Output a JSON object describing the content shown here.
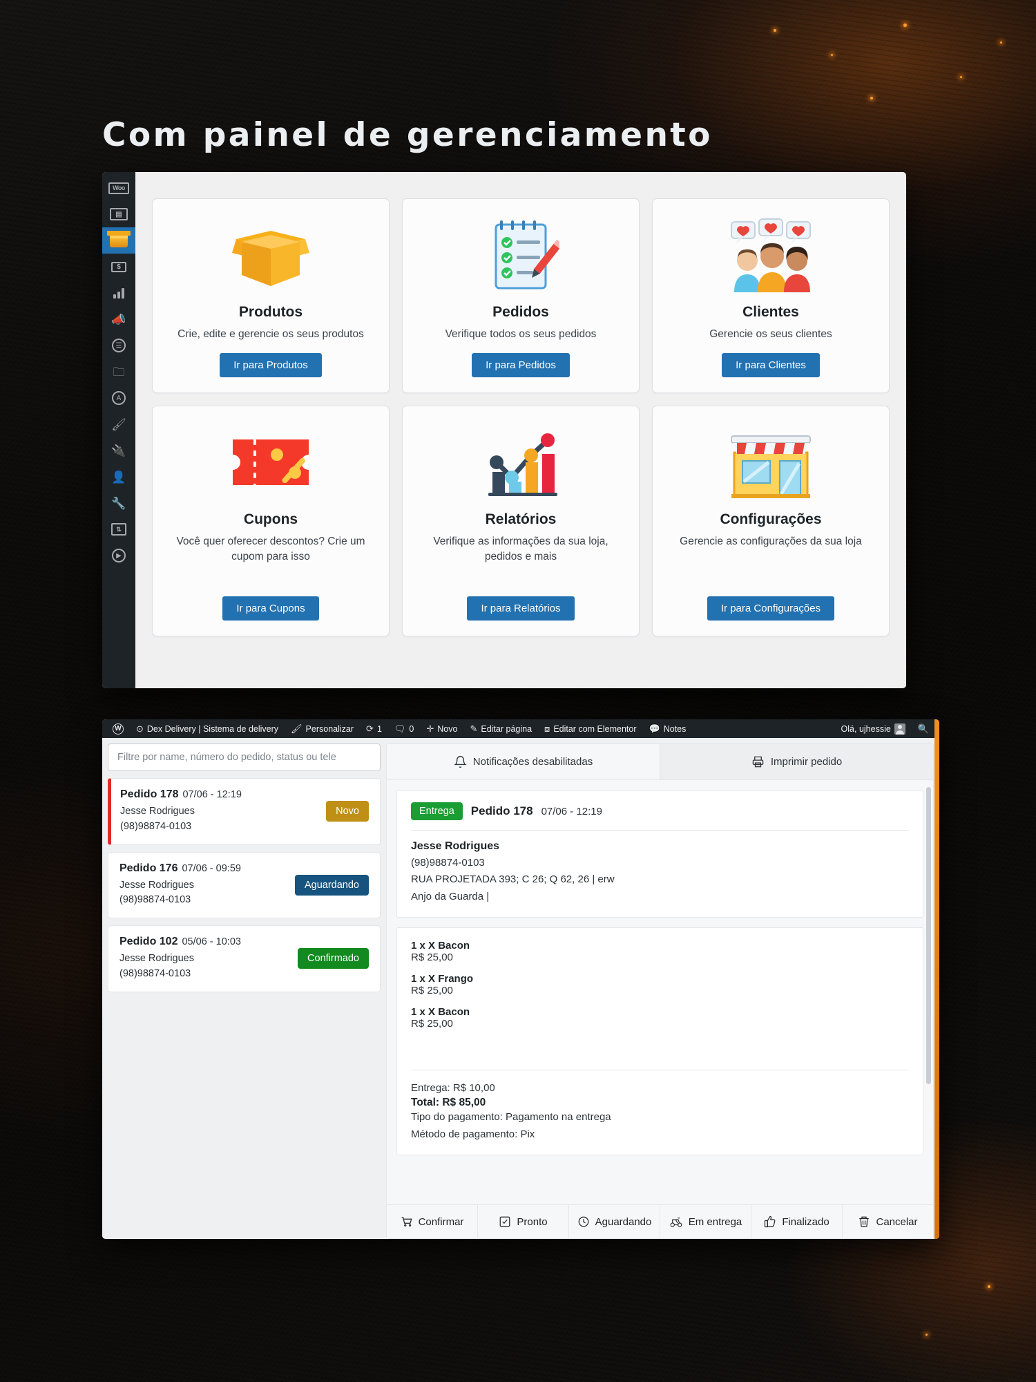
{
  "headline": "Com painel de gerenciamento",
  "dashboard": {
    "rail": [
      {
        "name": "woocommerce-icon",
        "glyph": "Woo"
      },
      {
        "name": "pages-icon",
        "glyph": "▤"
      },
      {
        "name": "products-icon",
        "glyph": "box"
      },
      {
        "name": "payments-icon",
        "glyph": "S"
      },
      {
        "name": "analytics-icon",
        "glyph": "bars"
      },
      {
        "name": "marketing-icon",
        "glyph": "📣"
      },
      {
        "name": "elementor-icon",
        "glyph": "E"
      },
      {
        "name": "media-icon",
        "glyph": "🗀"
      },
      {
        "name": "astra-icon",
        "glyph": "A"
      },
      {
        "name": "appearance-icon",
        "glyph": "🖌"
      },
      {
        "name": "plugins-icon",
        "glyph": "🔌"
      },
      {
        "name": "users-icon",
        "glyph": "👤"
      },
      {
        "name": "tools-icon",
        "glyph": "🔧"
      },
      {
        "name": "settings-icon",
        "glyph": "⇅"
      },
      {
        "name": "collapse-icon",
        "glyph": "▶"
      }
    ],
    "cards": [
      {
        "id": "produtos",
        "icon": "open-box-icon",
        "title": "Produtos",
        "desc": "Crie, edite e gerencie os seus produtos",
        "button": "Ir para Produtos"
      },
      {
        "id": "pedidos",
        "icon": "checklist-icon",
        "title": "Pedidos",
        "desc": "Verifique todos os seus pedidos",
        "button": "Ir para Pedidos"
      },
      {
        "id": "clientes",
        "icon": "customers-icon",
        "title": "Clientes",
        "desc": "Gerencie os seus clientes",
        "button": "Ir para Clientes"
      },
      {
        "id": "cupons",
        "icon": "coupon-icon",
        "title": "Cupons",
        "desc": "Você quer oferecer descontos? Crie um cupom para isso",
        "button": "Ir para Cupons"
      },
      {
        "id": "relatorios",
        "icon": "bar-chart-icon",
        "title": "Relatórios",
        "desc": "Verifique as informações da sua loja, pedidos e mais",
        "button": "Ir para Relatórios"
      },
      {
        "id": "configuracoes",
        "icon": "storefront-icon",
        "title": "Configurações",
        "desc": "Gerencie as configurações da sua loja",
        "button": "Ir para Configurações"
      }
    ]
  },
  "delivery": {
    "adminbar": {
      "site_name": "Dex Delivery | Sistema de delivery",
      "customize": "Personalizar",
      "updates_count": "1",
      "comments_count": "0",
      "new": "Novo",
      "edit_page": "Editar página",
      "edit_elementor": "Editar com Elementor",
      "notes": "Notes",
      "greeting": "Olá, ujhessie"
    },
    "filter_placeholder": "Filtre por name, número do pedido, status ou tele",
    "orders": [
      {
        "number": "Pedido 178",
        "datetime": "07/06 - 12:19",
        "customer": "Jesse Rodrigues",
        "phone": "(98)98874-0103",
        "status": "Novo",
        "status_color": "#bf8f16",
        "selected": true
      },
      {
        "number": "Pedido 176",
        "datetime": "07/06 - 09:59",
        "customer": "Jesse Rodrigues",
        "phone": "(98)98874-0103",
        "status": "Aguardando",
        "status_color": "#16537e",
        "selected": false
      },
      {
        "number": "Pedido 102",
        "datetime": "05/06 - 10:03",
        "customer": "Jesse Rodrigues",
        "phone": "(98)98874-0103",
        "status": "Confirmado",
        "status_color": "#128a1f",
        "selected": false
      }
    ],
    "detail_tabs": [
      {
        "label": "Notificações desabilitadas",
        "icon": "bell-icon"
      },
      {
        "label": "Imprimir pedido",
        "icon": "printer-icon"
      }
    ],
    "detail": {
      "chip": "Entrega",
      "chip_color": "#1a9e34",
      "number": "Pedido 178",
      "datetime": "07/06 - 12:19",
      "customer": "Jesse Rodrigues",
      "phone": "(98)98874-0103",
      "address_line1": "RUA PROJETADA 393; C 26; Q 62, 26 | erw",
      "address_line2": "Anjo da Guarda |",
      "items": [
        {
          "name": "1 x X Bacon",
          "price": "R$ 25,00"
        },
        {
          "name": "1 x X Frango",
          "price": "R$ 25,00"
        },
        {
          "name": "1 x X Bacon",
          "price": "R$ 25,00"
        }
      ],
      "delivery_fee": "Entrega: R$ 10,00",
      "total": "Total: R$ 85,00",
      "payment_type": "Tipo do pagamento: Pagamento na entrega",
      "payment_method": "Método de pagamento: Pix"
    },
    "actions": [
      {
        "label": "Confirmar",
        "icon": "cart-icon"
      },
      {
        "label": "Pronto",
        "icon": "check-square-icon"
      },
      {
        "label": "Aguardando",
        "icon": "clock-icon"
      },
      {
        "label": "Em entrega",
        "icon": "scooter-icon"
      },
      {
        "label": "Finalizado",
        "icon": "thumbs-up-icon"
      },
      {
        "label": "Cancelar",
        "icon": "trash-icon"
      }
    ]
  }
}
